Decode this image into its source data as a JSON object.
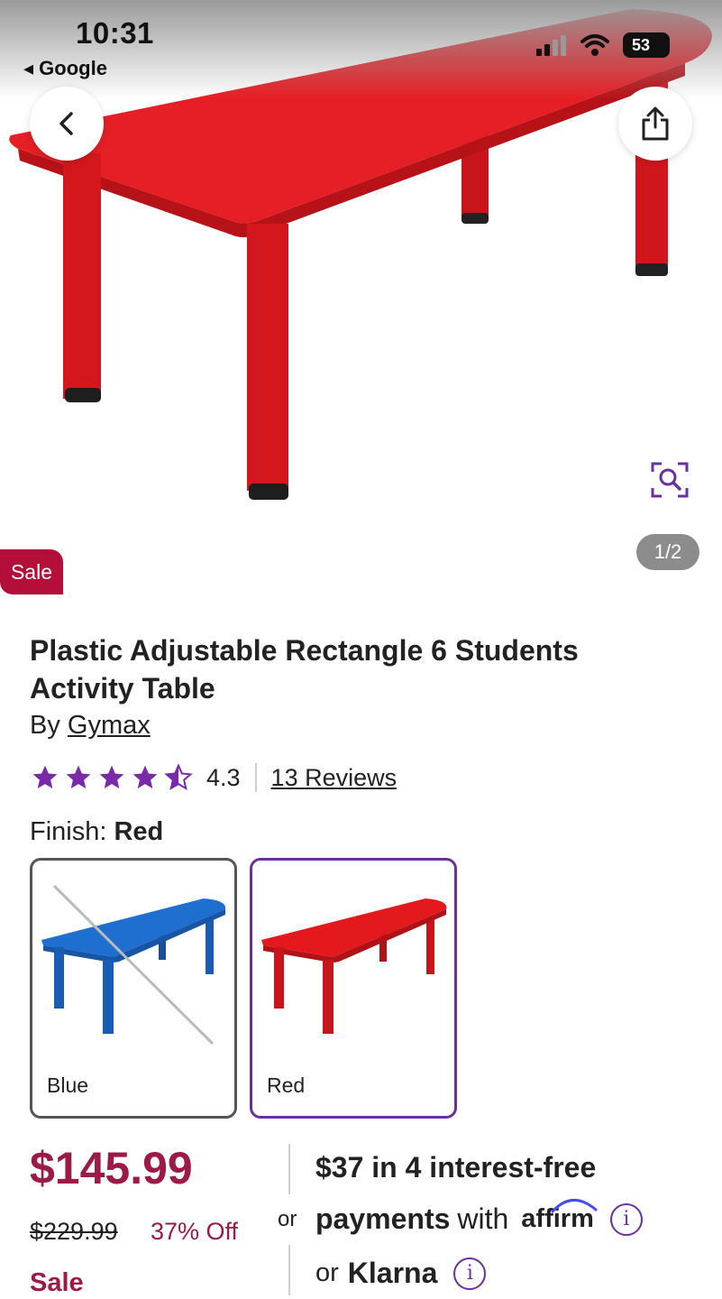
{
  "status_bar": {
    "time": "10:31",
    "back_app": "Google",
    "battery": "53"
  },
  "gallery": {
    "counter": "1/2",
    "sale_badge": "Sale"
  },
  "product": {
    "title": "Plastic Adjustable Rectangle 6 Students Activity Table",
    "by_prefix": "By",
    "brand": "Gymax",
    "rating": "4.3",
    "rating_value": 4.3,
    "reviews": "13 Reviews"
  },
  "finish": {
    "label": "Finish:",
    "selected": "Red",
    "options": [
      {
        "label": "Blue",
        "color": "#1f6fd1",
        "available": false
      },
      {
        "label": "Red",
        "color": "#e3191e",
        "available": true,
        "selected": true
      }
    ]
  },
  "pricing": {
    "price": "$145.99",
    "was": "$229.99",
    "off": "37% Off",
    "sale": "Sale",
    "or": "or",
    "installment_amount": "$37",
    "installment_text": "in 4 interest-free",
    "payments_bold": "payments",
    "with": "with",
    "affirm": "affirm",
    "or_prefix": "or",
    "klarna": "Klarna"
  },
  "colors": {
    "accent_purple": "#6b2fa0",
    "sale_red": "#9c1a45",
    "badge_red": "#b40f3b",
    "table_red": "#e3191e",
    "table_blue": "#1f6fd1"
  }
}
